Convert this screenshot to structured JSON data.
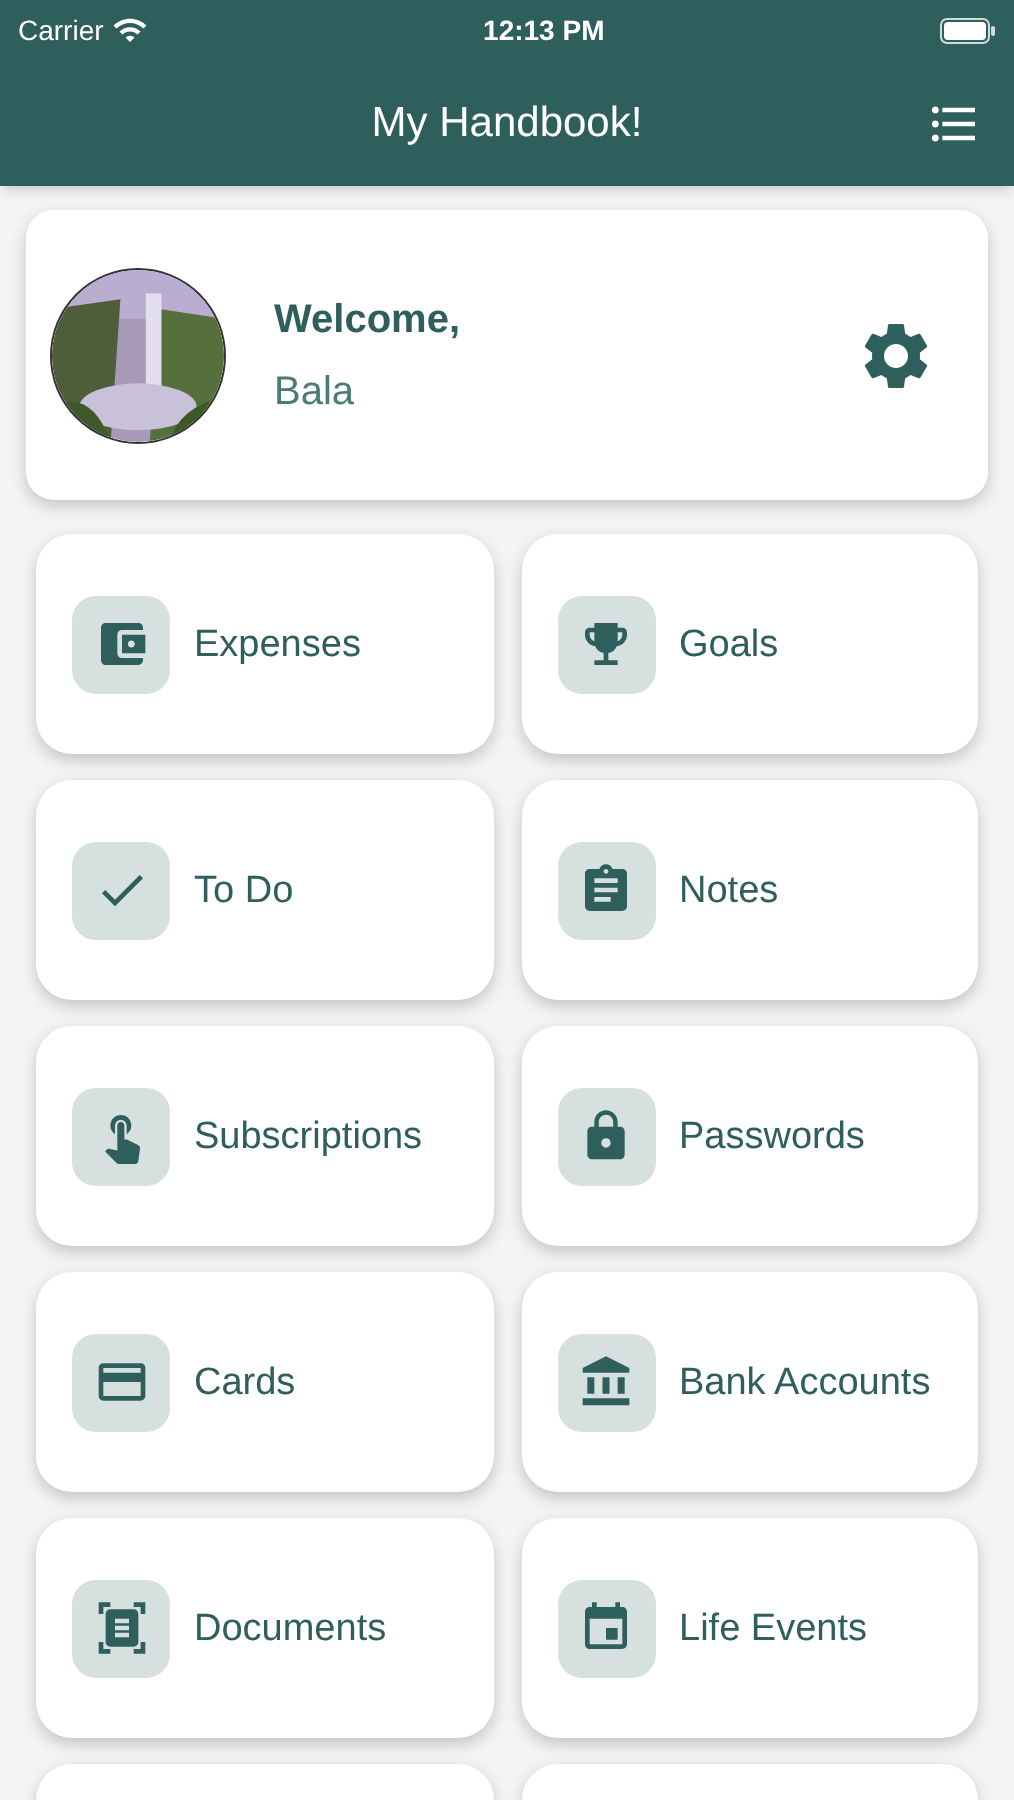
{
  "status_bar": {
    "carrier": "Carrier",
    "time": "12:13 PM"
  },
  "header": {
    "title": "My Handbook!"
  },
  "profile": {
    "greeting": "Welcome,",
    "name": "Bala"
  },
  "tiles": [
    {
      "label": "Expenses"
    },
    {
      "label": "Goals"
    },
    {
      "label": "To Do"
    },
    {
      "label": "Notes"
    },
    {
      "label": "Subscriptions"
    },
    {
      "label": "Passwords"
    },
    {
      "label": "Cards"
    },
    {
      "label": "Bank Accounts"
    },
    {
      "label": "Documents"
    },
    {
      "label": "Life Events"
    }
  ]
}
